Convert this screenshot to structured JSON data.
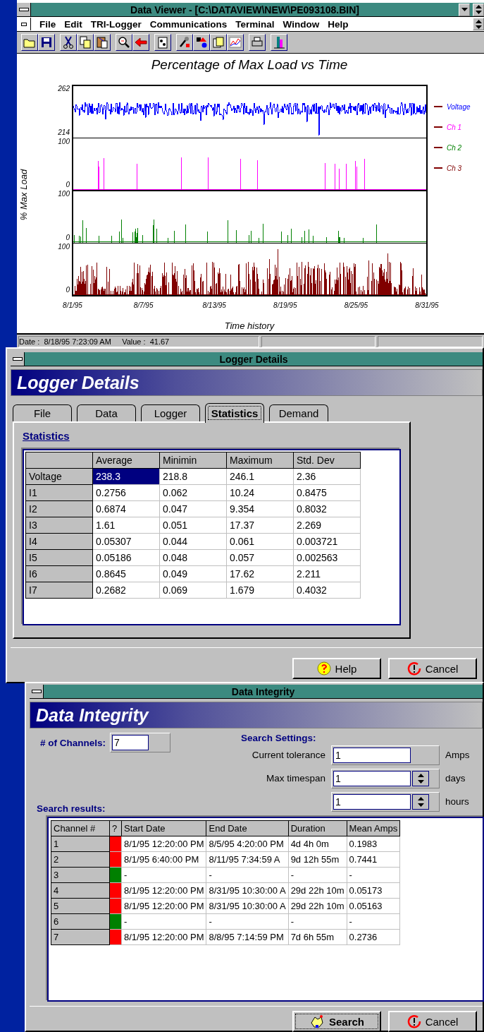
{
  "viewer": {
    "title": "Data Viewer - [C:\\DATAVIEW\\NEW\\PE093108.BIN]",
    "menu": [
      "File",
      "Edit",
      "TRI-Logger",
      "Communications",
      "Terminal",
      "Window",
      "Help"
    ],
    "chart": {
      "title": "Percentage of Max Load vs Time",
      "ylabel": "% Max Load",
      "xlabel": "Time history",
      "xticks": [
        "8/1/95",
        "8/7/95",
        "8/13/95",
        "8/19/95",
        "8/25/95",
        "8/31/95"
      ],
      "series": [
        {
          "name": "Voltage",
          "color": "#0000ff",
          "kind": "line",
          "ymax": "262",
          "ymin": "214"
        },
        {
          "name": "Ch 1",
          "color": "#ff00ff",
          "kind": "spikes",
          "ymax": "100",
          "ymin": "0"
        },
        {
          "name": "Ch 2",
          "color": "#008000",
          "kind": "spikes",
          "ymax": "100",
          "ymin": "0"
        },
        {
          "name": "Ch 3",
          "color": "#800000",
          "kind": "bars",
          "ymax": "100",
          "ymin": "0"
        }
      ]
    },
    "status": "Date :  8/18/95 7:23:09 AM     Value :  41.67"
  },
  "logger": {
    "title": "Logger Details",
    "banner": "Logger Details",
    "tabs": [
      {
        "label": "File",
        "selected": false
      },
      {
        "label": "Data",
        "selected": false
      },
      {
        "label": "Logger",
        "selected": false
      },
      {
        "label": "Statistics",
        "selected": true
      },
      {
        "label": "Demand",
        "selected": false
      }
    ],
    "heading": "Statistics",
    "columns": [
      "Average",
      "Minimin",
      "Maximum",
      "Std. Dev"
    ],
    "rows": [
      {
        "label": "Voltage",
        "cells": [
          {
            "text": "238.3",
            "selected": true
          },
          {
            "text": "218.8",
            "selected": false
          },
          {
            "text": "246.1",
            "selected": false
          },
          {
            "text": "2.36",
            "selected": false
          }
        ]
      },
      {
        "label": "I1",
        "cells": [
          {
            "text": "0.2756",
            "selected": false
          },
          {
            "text": "0.062",
            "selected": false
          },
          {
            "text": "10.24",
            "selected": false
          },
          {
            "text": "0.8475",
            "selected": false
          }
        ]
      },
      {
        "label": "I2",
        "cells": [
          {
            "text": "0.6874",
            "selected": false
          },
          {
            "text": "0.047",
            "selected": false
          },
          {
            "text": "9.354",
            "selected": false
          },
          {
            "text": "0.8032",
            "selected": false
          }
        ]
      },
      {
        "label": "I3",
        "cells": [
          {
            "text": "1.61",
            "selected": false
          },
          {
            "text": "0.051",
            "selected": false
          },
          {
            "text": "17.37",
            "selected": false
          },
          {
            "text": "2.269",
            "selected": false
          }
        ]
      },
      {
        "label": "I4",
        "cells": [
          {
            "text": "0.05307",
            "selected": false
          },
          {
            "text": "0.044",
            "selected": false
          },
          {
            "text": "0.061",
            "selected": false
          },
          {
            "text": "0.003721",
            "selected": false
          }
        ]
      },
      {
        "label": "I5",
        "cells": [
          {
            "text": "0.05186",
            "selected": false
          },
          {
            "text": "0.048",
            "selected": false
          },
          {
            "text": "0.057",
            "selected": false
          },
          {
            "text": "0.002563",
            "selected": false
          }
        ]
      },
      {
        "label": "I6",
        "cells": [
          {
            "text": "0.8645",
            "selected": false
          },
          {
            "text": "0.049",
            "selected": false
          },
          {
            "text": "17.62",
            "selected": false
          },
          {
            "text": "2.211",
            "selected": false
          }
        ]
      },
      {
        "label": "I7",
        "cells": [
          {
            "text": "0.2682",
            "selected": false
          },
          {
            "text": "0.069",
            "selected": false
          },
          {
            "text": "1.679",
            "selected": false
          },
          {
            "text": "0.4032",
            "selected": false
          }
        ]
      }
    ],
    "buttons": [
      {
        "label": "Help",
        "kind": "help",
        "focused": false
      },
      {
        "label": "Cancel",
        "kind": "cancel",
        "focused": false
      }
    ]
  },
  "integrity": {
    "title": "Data Integrity",
    "banner": "Data Integrity",
    "channels_label": "# of Channels:",
    "channels_value": "7",
    "settings_label": "Search Settings:",
    "settings": [
      {
        "label": "Current tolerance",
        "value": "1",
        "spinner": false,
        "unit": "Amps"
      },
      {
        "label": "Max timespan",
        "value": "1",
        "spinner": true,
        "unit": "days"
      },
      {
        "value": "1",
        "spinner": true,
        "unit": "hours"
      }
    ],
    "results_label": "Search results:",
    "columns": [
      "Channel #",
      "?",
      "Start Date",
      "End Date",
      "Duration",
      "Mean Amps"
    ],
    "rows": [
      {
        "channel": "1",
        "color": "#ff0000",
        "start": "8/1/95 12:20:00 PM",
        "end": "8/5/95 4:20:00 PM",
        "duration": "4d 4h 0m",
        "mean": "0.1983"
      },
      {
        "channel": "2",
        "color": "#ff0000",
        "start": "8/1/95 6:40:00 PM",
        "end": "8/11/95 7:34:59 A",
        "duration": "9d 12h 55m",
        "mean": "0.7441"
      },
      {
        "channel": "3",
        "color": "#008000",
        "start": "-",
        "end": "-",
        "duration": "-",
        "mean": "-"
      },
      {
        "channel": "4",
        "color": "#ff0000",
        "start": "8/1/95 12:20:00 PM",
        "end": "8/31/95 10:30:00 A",
        "duration": "29d 22h 10m",
        "mean": "0.05173"
      },
      {
        "channel": "5",
        "color": "#ff0000",
        "start": "8/1/95 12:20:00 PM",
        "end": "8/31/95 10:30:00 A",
        "duration": "29d 22h 10m",
        "mean": "0.05163"
      },
      {
        "channel": "6",
        "color": "#008000",
        "start": "-",
        "end": "-",
        "duration": "-",
        "mean": "-"
      },
      {
        "channel": "7",
        "color": "#ff0000",
        "start": "8/1/95 12:20:00 PM",
        "end": "8/8/95 7:14:59 PM",
        "duration": "7d 6h 55m",
        "mean": "0.2736"
      }
    ],
    "buttons": [
      {
        "label": "Search",
        "kind": "search",
        "focused": true
      },
      {
        "label": "Cancel",
        "kind": "cancel",
        "focused": false
      }
    ]
  }
}
